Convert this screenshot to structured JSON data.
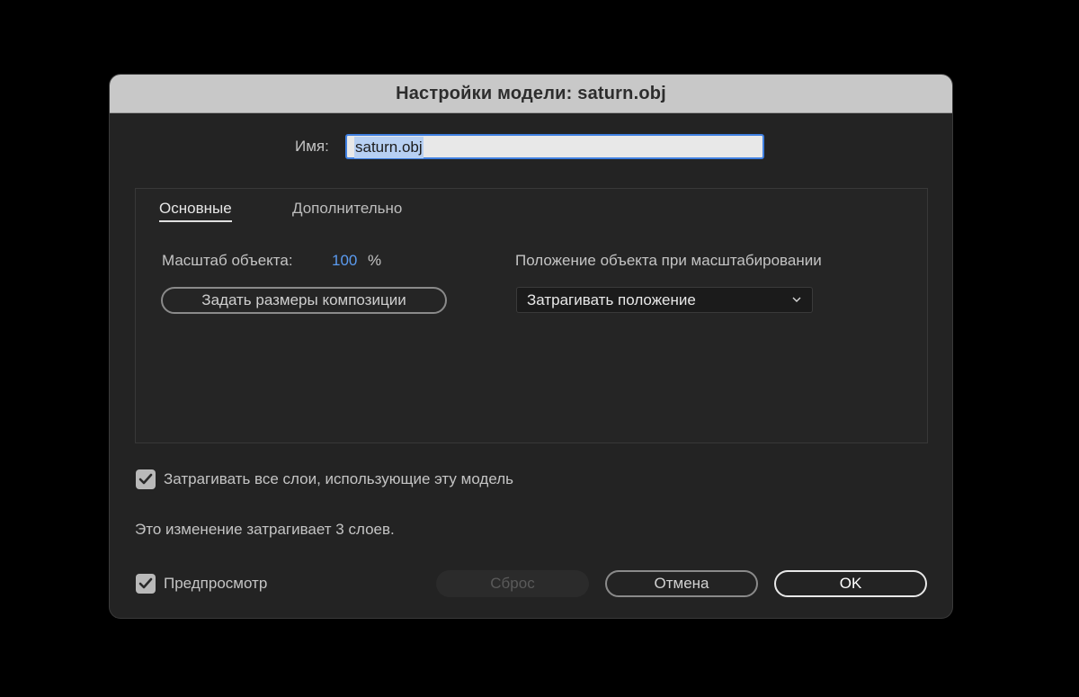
{
  "dialog": {
    "title": "Настройки модели: saturn.obj"
  },
  "name": {
    "label": "Имя:",
    "value": "saturn.obj"
  },
  "tabs": [
    {
      "label": "Основные",
      "active": true
    },
    {
      "label": "Дополнительно",
      "active": false
    }
  ],
  "basic": {
    "scale_label": "Масштаб объекта:",
    "scale_value": "100",
    "scale_unit": "%",
    "set_comp_size_button": "Задать размеры композиции",
    "position_label": "Положение объекта при масштабировании",
    "position_select_value": "Затрагивать положение"
  },
  "affect_all_layers": {
    "label": "Затрагивать все слои, использующие эту модель",
    "checked": true
  },
  "info_text": "Это изменение затрагивает 3 слоев.",
  "preview": {
    "label": "Предпросмотр",
    "checked": true
  },
  "buttons": {
    "reset": "Сброс",
    "cancel": "Отмена",
    "ok": "OK"
  },
  "colors": {
    "accent_blue": "#5b9bf0",
    "focus_border": "#3f7fe0",
    "dialog_bg": "#232323",
    "titlebar_bg": "#c8c8c8"
  },
  "icons": {
    "checkbox_check": "checkmark-icon",
    "select_chevron": "chevron-down-icon"
  }
}
